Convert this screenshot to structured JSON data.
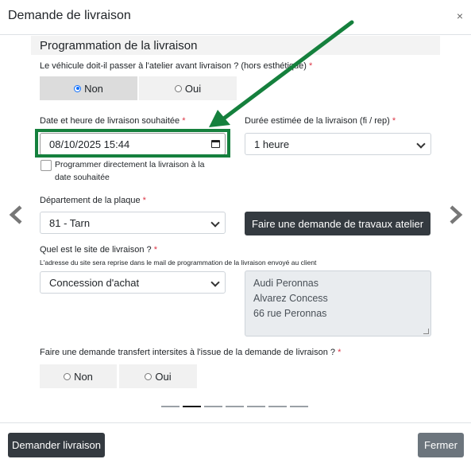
{
  "modal": {
    "title": "Demande de livraison",
    "close_symbol": "×"
  },
  "section": {
    "title": "Programmation de la livraison"
  },
  "vehicle_question": {
    "label": "Le véhicule doit-il passer à l'atelier avant livraison ? (hors esthétique)",
    "required_mark": "*",
    "options": [
      {
        "label": "Non",
        "selected": true
      },
      {
        "label": "Oui",
        "selected": false
      }
    ]
  },
  "delivery_date": {
    "label": "Date et heure de livraison souhaitée",
    "required_mark": "*",
    "value": "08/10/2025 15:44"
  },
  "duration": {
    "label": "Durée estimée de la livraison (fi / rep)",
    "required_mark": "*",
    "value": "1 heure"
  },
  "direct_schedule": {
    "label_line1": "Programmer directement la livraison à la",
    "label_line2": "date souhaitée",
    "checked": false
  },
  "plate_department": {
    "label": "Département de la plaque",
    "required_mark": "*",
    "value": "81 - Tarn"
  },
  "workshop_button": {
    "label": "Faire une demande de travaux atelier"
  },
  "site": {
    "label": "Quel est le site de livraison ?",
    "required_mark": "*",
    "note": "L'adresse du site sera reprise dans le mail de programmation de la livraison envoyé au client",
    "value": "Concession d'achat",
    "address_lines": [
      "Audi Peronnas",
      "Alvarez Concess",
      "66 rue Peronnas"
    ]
  },
  "transfer_question": {
    "label": "Faire une demande transfert intersites à l'issue de la demande de livraison ?",
    "required_mark": "*",
    "options": [
      {
        "label": "Non",
        "selected": false
      },
      {
        "label": "Oui",
        "selected": false
      }
    ]
  },
  "pagination": {
    "total": 7,
    "active_index": 1
  },
  "footer": {
    "submit_label": "Demander livraison",
    "close_label": "Fermer"
  },
  "colors": {
    "highlight": "#15803d",
    "required": "#dc3545",
    "dark_button": "#343a40",
    "gray_button": "#6c757d"
  }
}
